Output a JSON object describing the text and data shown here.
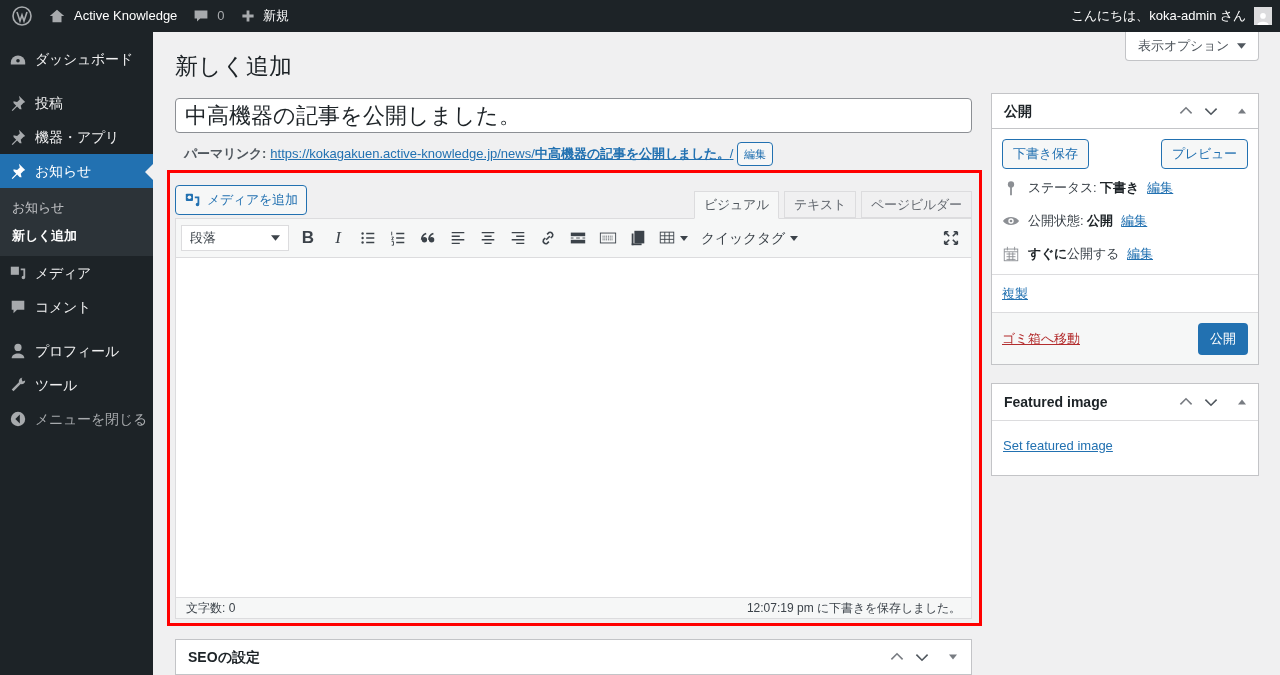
{
  "admin_bar": {
    "site_name": "Active Knowledge",
    "comment_count": "0",
    "new_label": "新規",
    "greeting": "こんにちは、koka-admin さん"
  },
  "sidebar": {
    "groups": [
      [
        {
          "kind": "dashboard",
          "label": "ダッシュボード",
          "selected": false
        }
      ],
      [
        {
          "kind": "pin",
          "label": "投稿",
          "selected": false
        },
        {
          "kind": "pin",
          "label": "機器・アプリ",
          "selected": false
        },
        {
          "kind": "pin",
          "label": "お知らせ",
          "selected": true,
          "children": [
            {
              "label": "お知らせ",
              "selected": false
            },
            {
              "label": "新しく追加",
              "selected": true
            }
          ]
        },
        {
          "kind": "media",
          "label": "メディア",
          "selected": false
        },
        {
          "kind": "comment",
          "label": "コメント",
          "selected": false
        }
      ],
      [
        {
          "kind": "user",
          "label": "プロフィール",
          "selected": false
        },
        {
          "kind": "wrench",
          "label": "ツール",
          "selected": false
        },
        {
          "kind": "collapse",
          "label": "メニューを閉じる",
          "selected": false
        }
      ]
    ]
  },
  "screen_options": "表示オプション",
  "page_title": "新しく追加",
  "post_title": "中高機器の記事を公開しました。",
  "permalink": {
    "label": "パーマリンク:",
    "url": "https://kokagakuen.active-knowledge.jp/news/**中高機器の記事を公開しました。**/",
    "edit": "編集"
  },
  "editor": {
    "add_media": "メディアを追加",
    "tabs": [
      {
        "label": "ビジュアル",
        "selected": true
      },
      {
        "label": "テキスト",
        "selected": false
      },
      {
        "label": "ページビルダー",
        "selected": false
      }
    ],
    "format": "段落",
    "toolbar": [
      {
        "kind": "bold",
        "label": "B"
      },
      {
        "kind": "italic",
        "label": "I"
      },
      {
        "kind": "bullets"
      },
      {
        "kind": "numbers"
      },
      {
        "kind": "quote"
      },
      {
        "kind": "align-left"
      },
      {
        "kind": "align-center"
      },
      {
        "kind": "align-right"
      },
      {
        "kind": "link"
      },
      {
        "kind": "more"
      },
      {
        "kind": "keyboard"
      },
      {
        "kind": "copy"
      },
      {
        "kind": "table"
      }
    ],
    "quick_tags": "クイックタグ",
    "word_count": "文字数: 0",
    "saved_status": "12:07:19 pm に下書きを保存しました。"
  },
  "publish": {
    "title": "公開",
    "save_draft": "下書き保存",
    "preview": "プレビュー",
    "rows": [
      {
        "kind": "status",
        "text": "ステータス: **下書き**",
        "edit": "編集"
      },
      {
        "kind": "visibility",
        "text": "公開状態: **公開**",
        "edit": "編集"
      },
      {
        "kind": "schedule",
        "text": "**すぐに**公開する",
        "edit": "編集"
      }
    ],
    "duplicate": "複製",
    "trash": "ゴミ箱へ移動",
    "publish_button": "公開"
  },
  "featured_image": {
    "title": "Featured image",
    "link": "Set featured image"
  },
  "seo": {
    "title": "SEOの設定"
  }
}
